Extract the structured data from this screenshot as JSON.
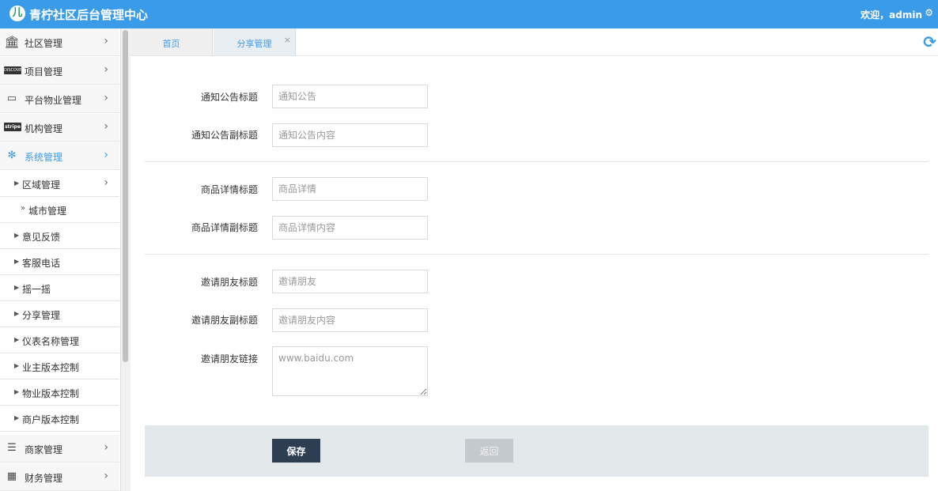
{
  "header": {
    "logo_glyph": "①",
    "title": "青柠社区后台管理中心",
    "welcome": "欢迎，admin",
    "settings_icon": "gear-icon"
  },
  "sidebar": {
    "items": [
      {
        "label": "社区管理",
        "icon": "bank-icon"
      },
      {
        "label": "项目管理",
        "icon": "discover-card-icon",
        "icon_text": "DISCOVER"
      },
      {
        "label": "平台物业管理",
        "icon": "monitor-icon"
      },
      {
        "label": "机构管理",
        "icon": "stripe-icon",
        "icon_text": "stripe"
      },
      {
        "label": "系统管理",
        "icon": "yelp-icon"
      }
    ],
    "system_sub": [
      {
        "label": "区域管理"
      },
      {
        "label": "城市管理"
      },
      {
        "label": "意见反馈"
      },
      {
        "label": "客服电话"
      },
      {
        "label": "摇一摇"
      },
      {
        "label": "分享管理"
      },
      {
        "label": "仪表名称管理"
      },
      {
        "label": "业主版本控制"
      },
      {
        "label": "物业版本控制"
      },
      {
        "label": "商户版本控制"
      }
    ],
    "bottom_items": [
      {
        "label": "商家管理",
        "icon": "list-icon"
      },
      {
        "label": "财务管理",
        "icon": "calculator-icon"
      }
    ],
    "active_color": "#3a9be9"
  },
  "tabs": [
    {
      "label": "首页"
    },
    {
      "label": "分享管理",
      "close": "×"
    }
  ],
  "form": {
    "notice_title_label": "通知公告标题",
    "notice_title_placeholder": "通知公告",
    "notice_subtitle_label": "通知公告副标题",
    "notice_subtitle_placeholder": "通知公告内容",
    "goods_title_label": "商品详情标题",
    "goods_title_placeholder": "商品详情",
    "goods_subtitle_label": "商品详情副标题",
    "goods_subtitle_placeholder": "商品详情内容",
    "invite_title_label": "邀请朋友标题",
    "invite_title_placeholder": "邀请朋友",
    "invite_subtitle_label": "邀请朋友副标题",
    "invite_subtitle_placeholder": "邀请朋友内容",
    "invite_link_label": "邀请朋友链接",
    "invite_link_placeholder": "www.baidu.com",
    "save_label": "保存",
    "back_label": "返回"
  },
  "colors": {
    "header_bg": "#3a9be9",
    "save_bg": "#2c3e50",
    "back_bg": "#c4c9cd"
  }
}
